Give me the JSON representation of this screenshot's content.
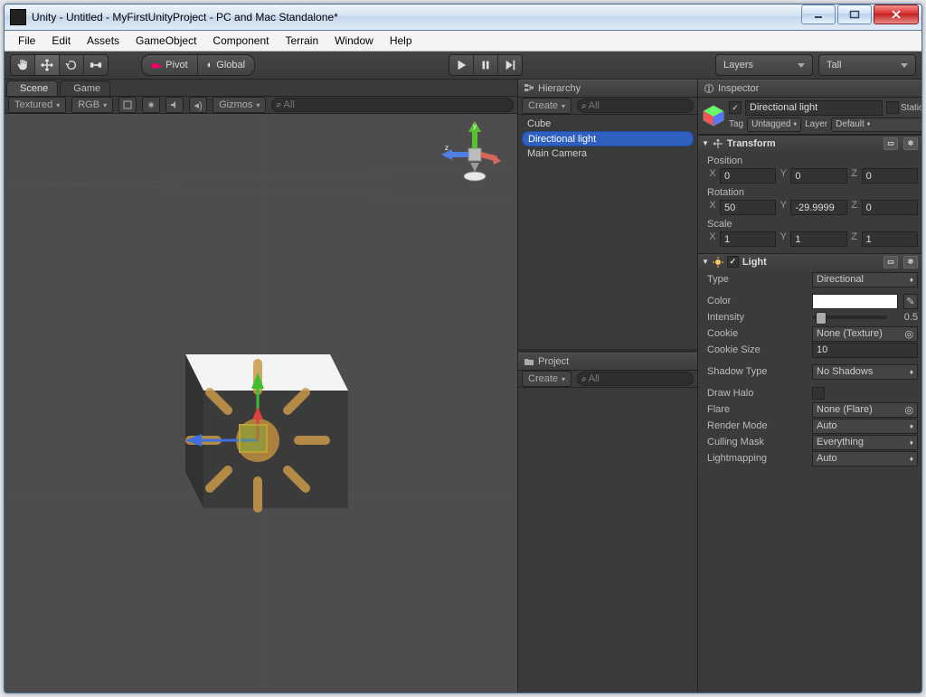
{
  "title": "Unity - Untitled - MyFirstUnityProject - PC and Mac Standalone*",
  "menu": [
    "File",
    "Edit",
    "Assets",
    "GameObject",
    "Component",
    "Terrain",
    "Window",
    "Help"
  ],
  "toolbar": {
    "pivot_label": "Pivot",
    "global_label": "Global",
    "layers_label": "Layers",
    "layout_label": "Tall"
  },
  "scene": {
    "tab_scene": "Scene",
    "tab_game": "Game",
    "shade_mode": "Textured",
    "render_mode": "RGB",
    "gizmos_label": "Gizmos",
    "search_placeholder": "All",
    "axis": {
      "x": "x",
      "y": "y",
      "z": "z"
    }
  },
  "hierarchy": {
    "title": "Hierarchy",
    "create": "Create",
    "search_placeholder": "All",
    "items": [
      "Cube",
      "Directional light",
      "Main Camera"
    ],
    "selected": 1
  },
  "project": {
    "title": "Project",
    "create": "Create",
    "search_placeholder": "All"
  },
  "inspector": {
    "title": "Inspector",
    "object_name": "Directional light",
    "static_label": "Static",
    "tag_label": "Tag",
    "tag_value": "Untagged",
    "layer_label": "Layer",
    "layer_value": "Default",
    "transform": {
      "title": "Transform",
      "position_label": "Position",
      "rotation_label": "Rotation",
      "scale_label": "Scale",
      "pos": {
        "x": "0",
        "y": "0",
        "z": "0"
      },
      "rot": {
        "x": "50",
        "y": "-29.9999",
        "z": "0"
      },
      "scale": {
        "x": "1",
        "y": "1",
        "z": "1"
      },
      "axes": {
        "x": "X",
        "y": "Y",
        "z": "Z"
      }
    },
    "light": {
      "title": "Light",
      "type_label": "Type",
      "type_value": "Directional",
      "color_label": "Color",
      "color_value": "#ffffff",
      "intensity_label": "Intensity",
      "intensity_value": "0.5",
      "cookie_label": "Cookie",
      "cookie_value": "None (Texture)",
      "cookie_size_label": "Cookie Size",
      "cookie_size_value": "10",
      "shadow_label": "Shadow Type",
      "shadow_value": "No Shadows",
      "halo_label": "Draw Halo",
      "flare_label": "Flare",
      "flare_value": "None (Flare)",
      "render_mode_label": "Render Mode",
      "render_mode_value": "Auto",
      "culling_label": "Culling Mask",
      "culling_value": "Everything",
      "lightmapping_label": "Lightmapping",
      "lightmapping_value": "Auto"
    }
  }
}
